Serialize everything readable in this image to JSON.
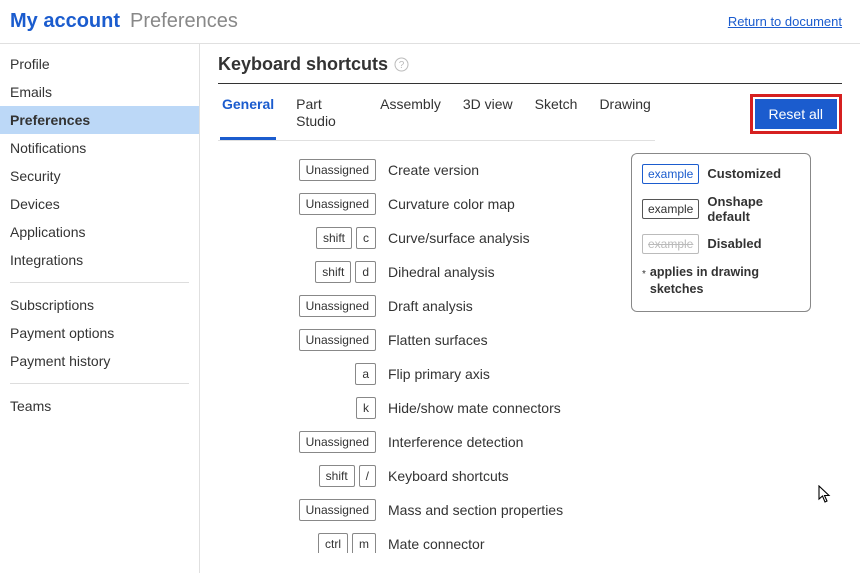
{
  "breadcrumb": {
    "root": "My account",
    "current": "Preferences"
  },
  "return_link": "Return to document",
  "sidebar": {
    "groupA": [
      "Profile",
      "Emails",
      "Preferences",
      "Notifications",
      "Security",
      "Devices",
      "Applications",
      "Integrations"
    ],
    "groupB": [
      "Subscriptions",
      "Payment options",
      "Payment history"
    ],
    "groupC": [
      "Teams"
    ],
    "active": "Preferences"
  },
  "section": {
    "title": "Keyboard shortcuts"
  },
  "tabs": [
    "General",
    "Part Studio",
    "Assembly",
    "3D view",
    "Sketch",
    "Drawing"
  ],
  "active_tab": "General",
  "reset_label": "Reset all",
  "shortcuts": [
    {
      "keys": [
        "Unassigned"
      ],
      "unassigned": true,
      "action": "Create version"
    },
    {
      "keys": [
        "Unassigned"
      ],
      "unassigned": true,
      "action": "Curvature color map"
    },
    {
      "keys": [
        "shift",
        "c"
      ],
      "unassigned": false,
      "action": "Curve/surface analysis"
    },
    {
      "keys": [
        "shift",
        "d"
      ],
      "unassigned": false,
      "action": "Dihedral analysis"
    },
    {
      "keys": [
        "Unassigned"
      ],
      "unassigned": true,
      "action": "Draft analysis"
    },
    {
      "keys": [
        "Unassigned"
      ],
      "unassigned": true,
      "action": "Flatten surfaces"
    },
    {
      "keys": [
        "a"
      ],
      "unassigned": false,
      "action": "Flip primary axis"
    },
    {
      "keys": [
        "k"
      ],
      "unassigned": false,
      "action": "Hide/show mate connectors"
    },
    {
      "keys": [
        "Unassigned"
      ],
      "unassigned": true,
      "action": "Interference detection"
    },
    {
      "keys": [
        "shift",
        "/"
      ],
      "unassigned": false,
      "action": "Keyboard shortcuts"
    },
    {
      "keys": [
        "Unassigned"
      ],
      "unassigned": true,
      "action": "Mass and section properties"
    },
    {
      "keys": [
        "ctrl",
        "m"
      ],
      "unassigned": false,
      "action": "Mate connector"
    }
  ],
  "legend": {
    "customized": {
      "sample": "example",
      "label": "Customized"
    },
    "default": {
      "sample": "example",
      "label": "Onshape default"
    },
    "disabled": {
      "sample": "example",
      "label": "Disabled"
    },
    "note_ast": "*",
    "note": "applies in drawing sketches"
  }
}
